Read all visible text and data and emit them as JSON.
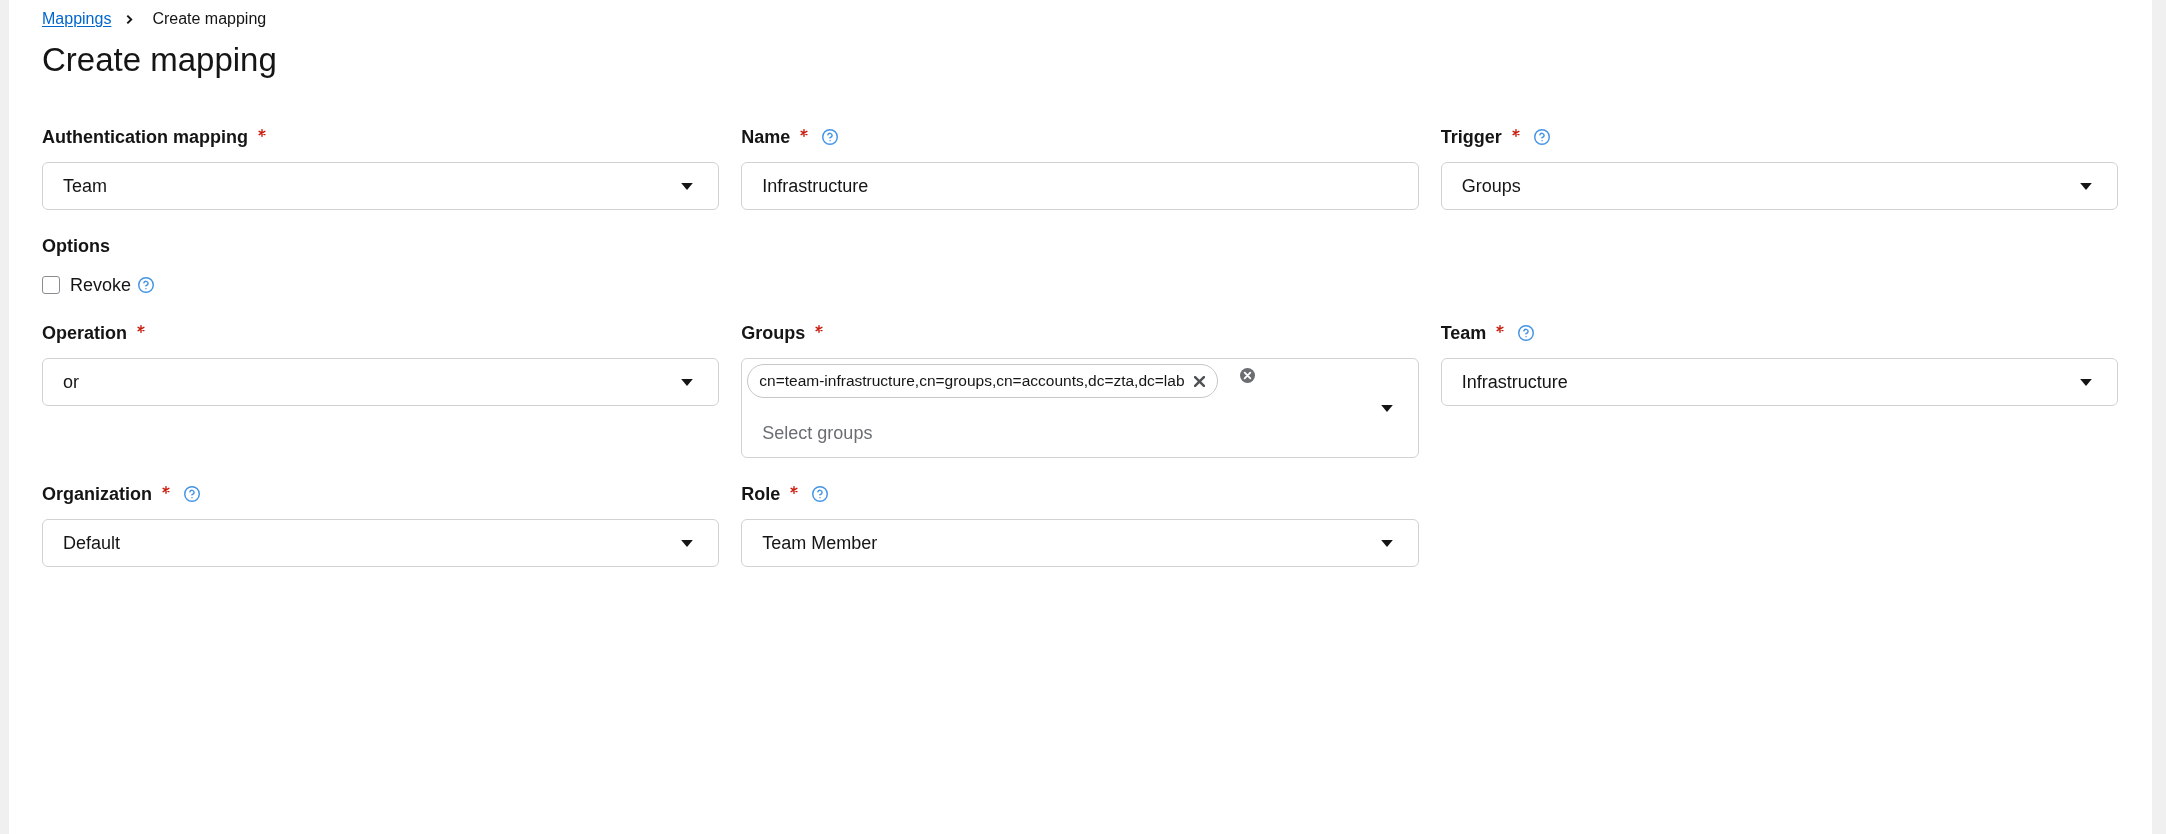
{
  "breadcrumb": [
    {
      "label": "Mappings",
      "kind": "link"
    },
    {
      "label": "Create mapping",
      "kind": "current"
    }
  ],
  "title": "Create mapping",
  "form": [
    {
      "kind": "row",
      "fields": [
        {
          "label": "Authentication mapping",
          "required": true,
          "help": false,
          "kind": "select",
          "value": "Team"
        },
        {
          "label": "Name",
          "required": true,
          "help": true,
          "kind": "text",
          "value": "Infrastructure"
        },
        {
          "label": "Trigger",
          "required": true,
          "help": true,
          "kind": "select",
          "value": "Groups"
        }
      ]
    },
    {
      "kind": "options",
      "label": "Options",
      "checkboxes": [
        {
          "label": "Revoke",
          "checked": false,
          "help": true
        }
      ]
    },
    {
      "kind": "row",
      "fields": [
        {
          "label": "Operation",
          "required": true,
          "help": false,
          "kind": "select",
          "value": "or"
        },
        {
          "label": "Groups",
          "required": true,
          "help": false,
          "kind": "multiselect",
          "chips": [
            "cn=team-infrastructure,cn=groups,cn=accounts,dc=zta,dc=lab"
          ],
          "placeholder": "Select groups"
        },
        {
          "label": "Team",
          "required": true,
          "help": true,
          "kind": "select",
          "value": "Infrastructure"
        }
      ]
    },
    {
      "kind": "row",
      "fields": [
        {
          "label": "Organization",
          "required": true,
          "help": true,
          "kind": "select",
          "value": "Default"
        },
        {
          "label": "Role",
          "required": true,
          "help": true,
          "kind": "select",
          "value": "Team Member"
        }
      ]
    }
  ]
}
